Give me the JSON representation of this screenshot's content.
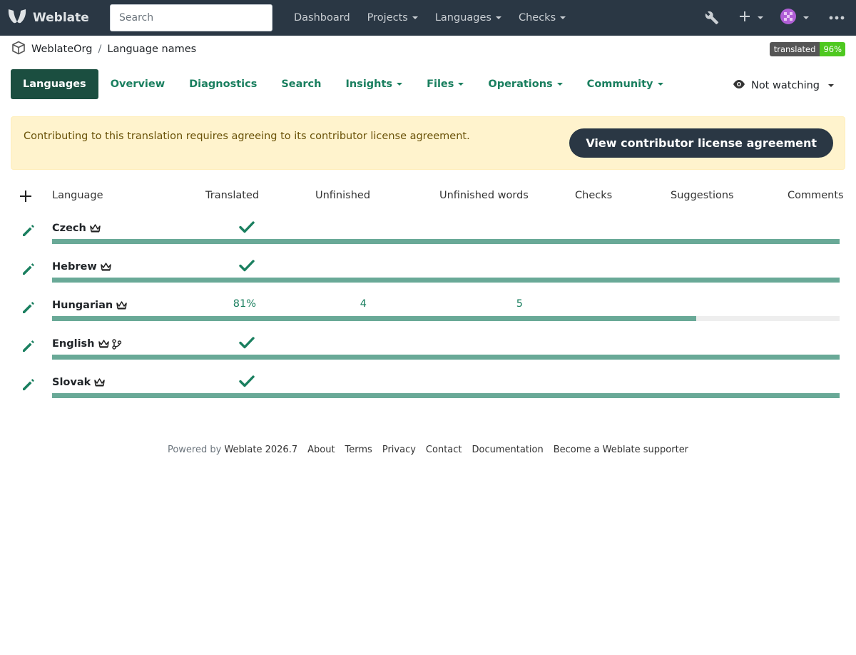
{
  "navbar": {
    "brand": "Weblate",
    "search_placeholder": "Search",
    "links": [
      {
        "label": "Dashboard",
        "dropdown": false
      },
      {
        "label": "Projects",
        "dropdown": true
      },
      {
        "label": "Languages",
        "dropdown": true
      },
      {
        "label": "Checks",
        "dropdown": true
      }
    ]
  },
  "breadcrumb": {
    "project": "WeblateOrg",
    "separator": "/",
    "component": "Language names"
  },
  "badge": {
    "label": "translated",
    "value": "96%"
  },
  "tabs": [
    {
      "label": "Languages",
      "active": true,
      "dropdown": false
    },
    {
      "label": "Overview",
      "active": false,
      "dropdown": false
    },
    {
      "label": "Diagnostics",
      "active": false,
      "dropdown": false
    },
    {
      "label": "Search",
      "active": false,
      "dropdown": false
    },
    {
      "label": "Insights",
      "active": false,
      "dropdown": true
    },
    {
      "label": "Files",
      "active": false,
      "dropdown": true
    },
    {
      "label": "Operations",
      "active": false,
      "dropdown": true
    },
    {
      "label": "Community",
      "active": false,
      "dropdown": true
    }
  ],
  "watch": {
    "label": "Not watching"
  },
  "alert": {
    "text": "Contributing to this translation requires agreeing to its contributor license agreement.",
    "button": "View contributor license agreement"
  },
  "table": {
    "headers": {
      "language": "Language",
      "translated": "Translated",
      "unfinished": "Unfinished",
      "unfinished_words": "Unfinished words",
      "checks": "Checks",
      "suggestions": "Suggestions",
      "comments": "Comments"
    },
    "rows": [
      {
        "name": "Czech",
        "translated": "",
        "complete": true,
        "unfinished": "",
        "unfinished_words": "",
        "progress": 100,
        "source": false
      },
      {
        "name": "Hebrew",
        "translated": "",
        "complete": true,
        "unfinished": "",
        "unfinished_words": "",
        "progress": 100,
        "source": false
      },
      {
        "name": "Hungarian",
        "translated": "81%",
        "complete": false,
        "unfinished": "4",
        "unfinished_words": "5",
        "progress": 81.8,
        "source": false
      },
      {
        "name": "English",
        "translated": "",
        "complete": true,
        "unfinished": "",
        "unfinished_words": "",
        "progress": 100,
        "source": true
      },
      {
        "name": "Slovak",
        "translated": "",
        "complete": true,
        "unfinished": "",
        "unfinished_words": "",
        "progress": 100,
        "source": false
      }
    ]
  },
  "footer": {
    "powered_by": "Powered by",
    "version": "Weblate 2026.7",
    "links": [
      "About",
      "Terms",
      "Privacy",
      "Contact",
      "Documentation",
      "Become a Weblate supporter"
    ]
  },
  "colors": {
    "navbar": "#2a3744",
    "accent": "#1a7f5f",
    "progress": "#69a997",
    "badge_value": "#4ec820"
  }
}
